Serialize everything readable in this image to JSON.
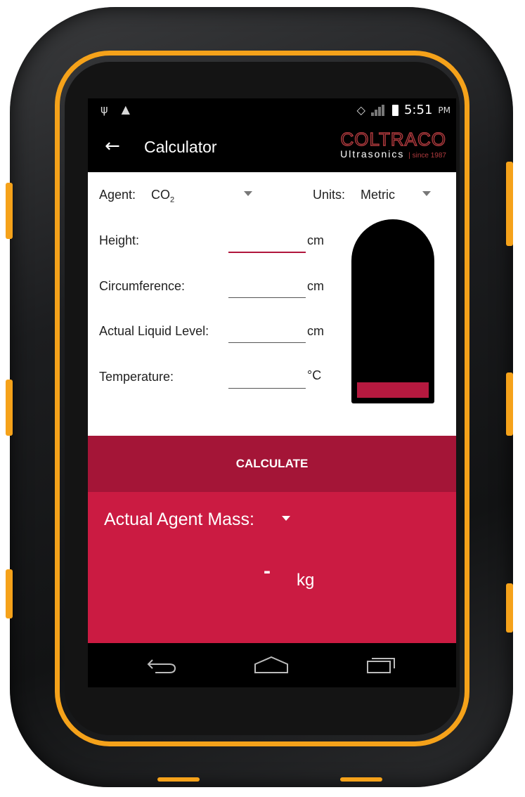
{
  "status_bar": {
    "left_icons": [
      "usb-icon",
      "warning-icon"
    ],
    "right_icons": [
      "rotate-icon",
      "signal-off-icon",
      "battery-icon"
    ],
    "time": "5:51",
    "ampm": "PM"
  },
  "app_bar": {
    "back_icon": "arrow-left-icon",
    "title": "Calculator",
    "logo_main": "COLTRACO",
    "logo_sub": "Ultrasonics",
    "logo_since": "since 1987"
  },
  "form": {
    "agent_label": "Agent:",
    "agent_value": "CO",
    "agent_subscript": "2",
    "units_label": "Units:",
    "units_value": "Metric",
    "rows": [
      {
        "label": "Height:",
        "value": "",
        "unit": "cm"
      },
      {
        "label": "Circumference:",
        "value": "",
        "unit": "cm"
      },
      {
        "label": "Actual Liquid Level:",
        "value": "",
        "unit": "cm"
      },
      {
        "label": "Temperature:",
        "value": "",
        "unit": "°C"
      }
    ]
  },
  "tank": {
    "fill_fraction": 0.09
  },
  "calculate_button": "CALCULATE",
  "result": {
    "label": "Actual Agent Mass:",
    "value": "-",
    "unit": "kg"
  },
  "nav_bar": [
    "back-icon",
    "home-icon",
    "recent-apps-icon"
  ],
  "colors": {
    "accent": "#cb1b42",
    "button": "#a41537",
    "device_trim": "#f5a21a"
  }
}
